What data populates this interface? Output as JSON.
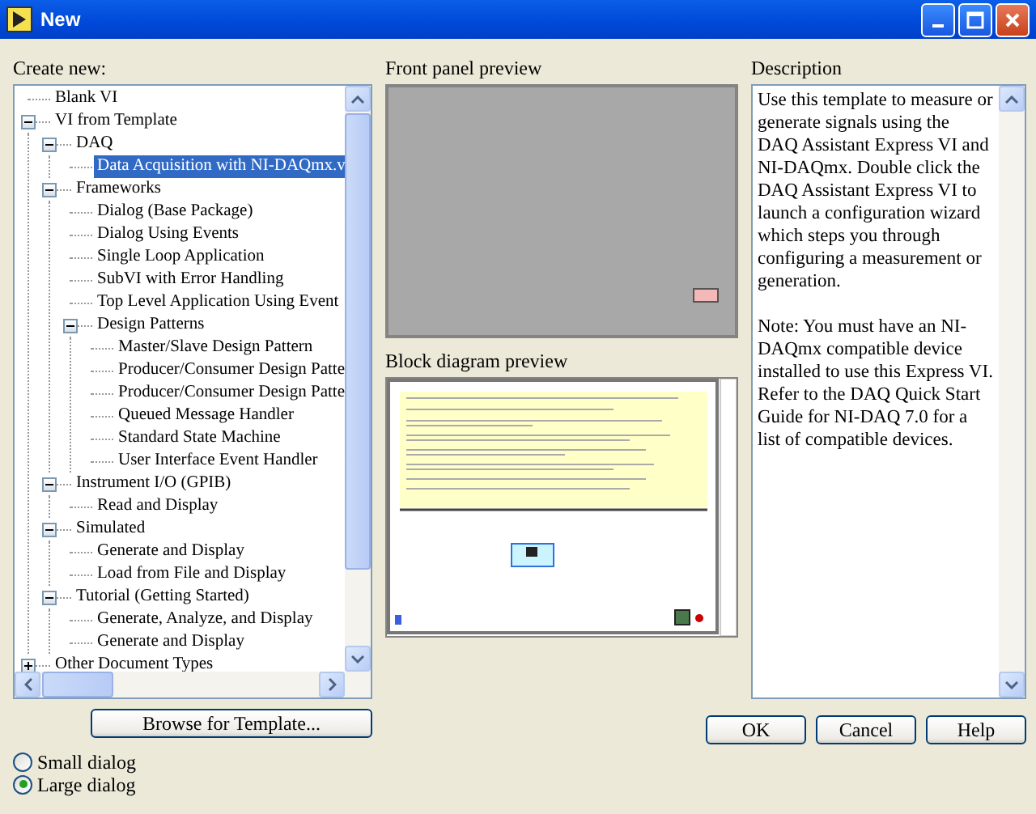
{
  "window": {
    "title": "New"
  },
  "create_new": {
    "label": "Create new:",
    "tree": [
      {
        "label": "Blank VI",
        "selected": false
      },
      {
        "label": "VI from Template",
        "selected": false,
        "expanded": true,
        "children": [
          {
            "label": "DAQ",
            "selected": false,
            "expanded": true,
            "children": [
              {
                "label": "Data Acquisition with NI-DAQmx.v",
                "selected": true
              }
            ]
          },
          {
            "label": "Frameworks",
            "selected": false,
            "expanded": true,
            "children": [
              {
                "label": "Dialog (Base Package)",
                "selected": false
              },
              {
                "label": "Dialog Using Events",
                "selected": false
              },
              {
                "label": "Single Loop Application",
                "selected": false
              },
              {
                "label": "SubVI with Error Handling",
                "selected": false
              },
              {
                "label": "Top Level Application Using Event",
                "selected": false
              },
              {
                "label": "Design Patterns",
                "selected": false,
                "expanded": true,
                "children": [
                  {
                    "label": "Master/Slave Design Pattern",
                    "selected": false
                  },
                  {
                    "label": "Producer/Consumer Design Patte",
                    "selected": false
                  },
                  {
                    "label": "Producer/Consumer Design Patte",
                    "selected": false
                  },
                  {
                    "label": "Queued Message Handler",
                    "selected": false
                  },
                  {
                    "label": "Standard State Machine",
                    "selected": false
                  },
                  {
                    "label": "User Interface Event Handler",
                    "selected": false
                  }
                ]
              }
            ]
          },
          {
            "label": "Instrument I/O (GPIB)",
            "selected": false,
            "expanded": true,
            "children": [
              {
                "label": "Read and Display",
                "selected": false
              }
            ]
          },
          {
            "label": "Simulated",
            "selected": false,
            "expanded": true,
            "children": [
              {
                "label": "Generate and Display",
                "selected": false
              },
              {
                "label": "Load from File and Display",
                "selected": false
              }
            ]
          },
          {
            "label": "Tutorial (Getting Started)",
            "selected": false,
            "expanded": true,
            "children": [
              {
                "label": "Generate, Analyze, and Display",
                "selected": false
              },
              {
                "label": "Generate and Display",
                "selected": false
              }
            ]
          }
        ]
      },
      {
        "label": "Other Document Types",
        "selected": false,
        "expanded": false
      }
    ]
  },
  "browse_button": "Browse for Template...",
  "dialog_size": [
    {
      "label": "Small dialog",
      "selected": false
    },
    {
      "label": "Large dialog",
      "selected": true
    }
  ],
  "front_panel_preview": {
    "label": "Front panel preview"
  },
  "block_diagram_preview": {
    "label": "Block diagram preview"
  },
  "description": {
    "label": "Description",
    "paragraphs": [
      "Use this template to measure or generate signals using the DAQ Assistant Express VI and NI-DAQmx.  Double click the  DAQ Assistant Express VI to launch a configuration wizard which steps you through configuring a measurement or generation.",
      "Note:  You must have an NI-DAQmx compatible device installed to use this Express VI.  Refer to the DAQ Quick Start Guide for NI-DAQ 7.0 for a list of compatible devices."
    ]
  },
  "buttons": [
    "OK",
    "Cancel",
    "Help"
  ]
}
